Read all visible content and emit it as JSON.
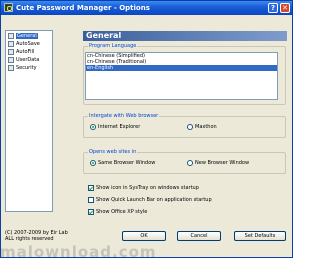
{
  "window": {
    "title": "Cute Password Manager - Options",
    "help_glyph": "?",
    "close_glyph": "✕"
  },
  "sidebar": {
    "items": [
      {
        "label": "General",
        "icon": "general-icon",
        "selected": true
      },
      {
        "label": "AutoSave",
        "icon": "autosave-icon"
      },
      {
        "label": "AutoFill",
        "icon": "autofill-icon"
      },
      {
        "label": "UserData",
        "icon": "userdata-icon"
      },
      {
        "label": "Security",
        "icon": "security-icon"
      }
    ]
  },
  "panel": {
    "title": "General",
    "program_language": {
      "label": "Program Language",
      "options": [
        "cn-Chinese (Simplified)",
        "cn-Chinese (Traditional)",
        "en-English"
      ],
      "selected": "en-English"
    },
    "browser_integration": {
      "label": "Intergate with Web browser",
      "options": [
        "Internet Explorer",
        "Maxthon"
      ],
      "selected": "Internet Explorer"
    },
    "opens_web_sites": {
      "label": "Opens web sites in",
      "options": [
        "Same Browser Window",
        "New Browser Window"
      ],
      "selected": "Same Browser Window"
    },
    "checkboxes": [
      {
        "label": "Show icon in SysTray on windows startup",
        "checked": true
      },
      {
        "label": "Show Quick Launch Bar on application startup",
        "checked": false
      },
      {
        "label": "Show Office XP style",
        "checked": true
      }
    ]
  },
  "footer": {
    "copyright_line1": "(C) 2007-2009 by Eir Lab",
    "copyright_line2": "ALL rights reserved",
    "buttons": {
      "ok": "OK",
      "cancel": "Cancel",
      "set_defaults": "Set Defaults"
    }
  },
  "watermark": "malownload.com",
  "colors": {
    "titlebar": "#0a45c2",
    "selection": "#316ac5",
    "group_label": "#0046d5",
    "panel_header": "#3a5f9c"
  }
}
